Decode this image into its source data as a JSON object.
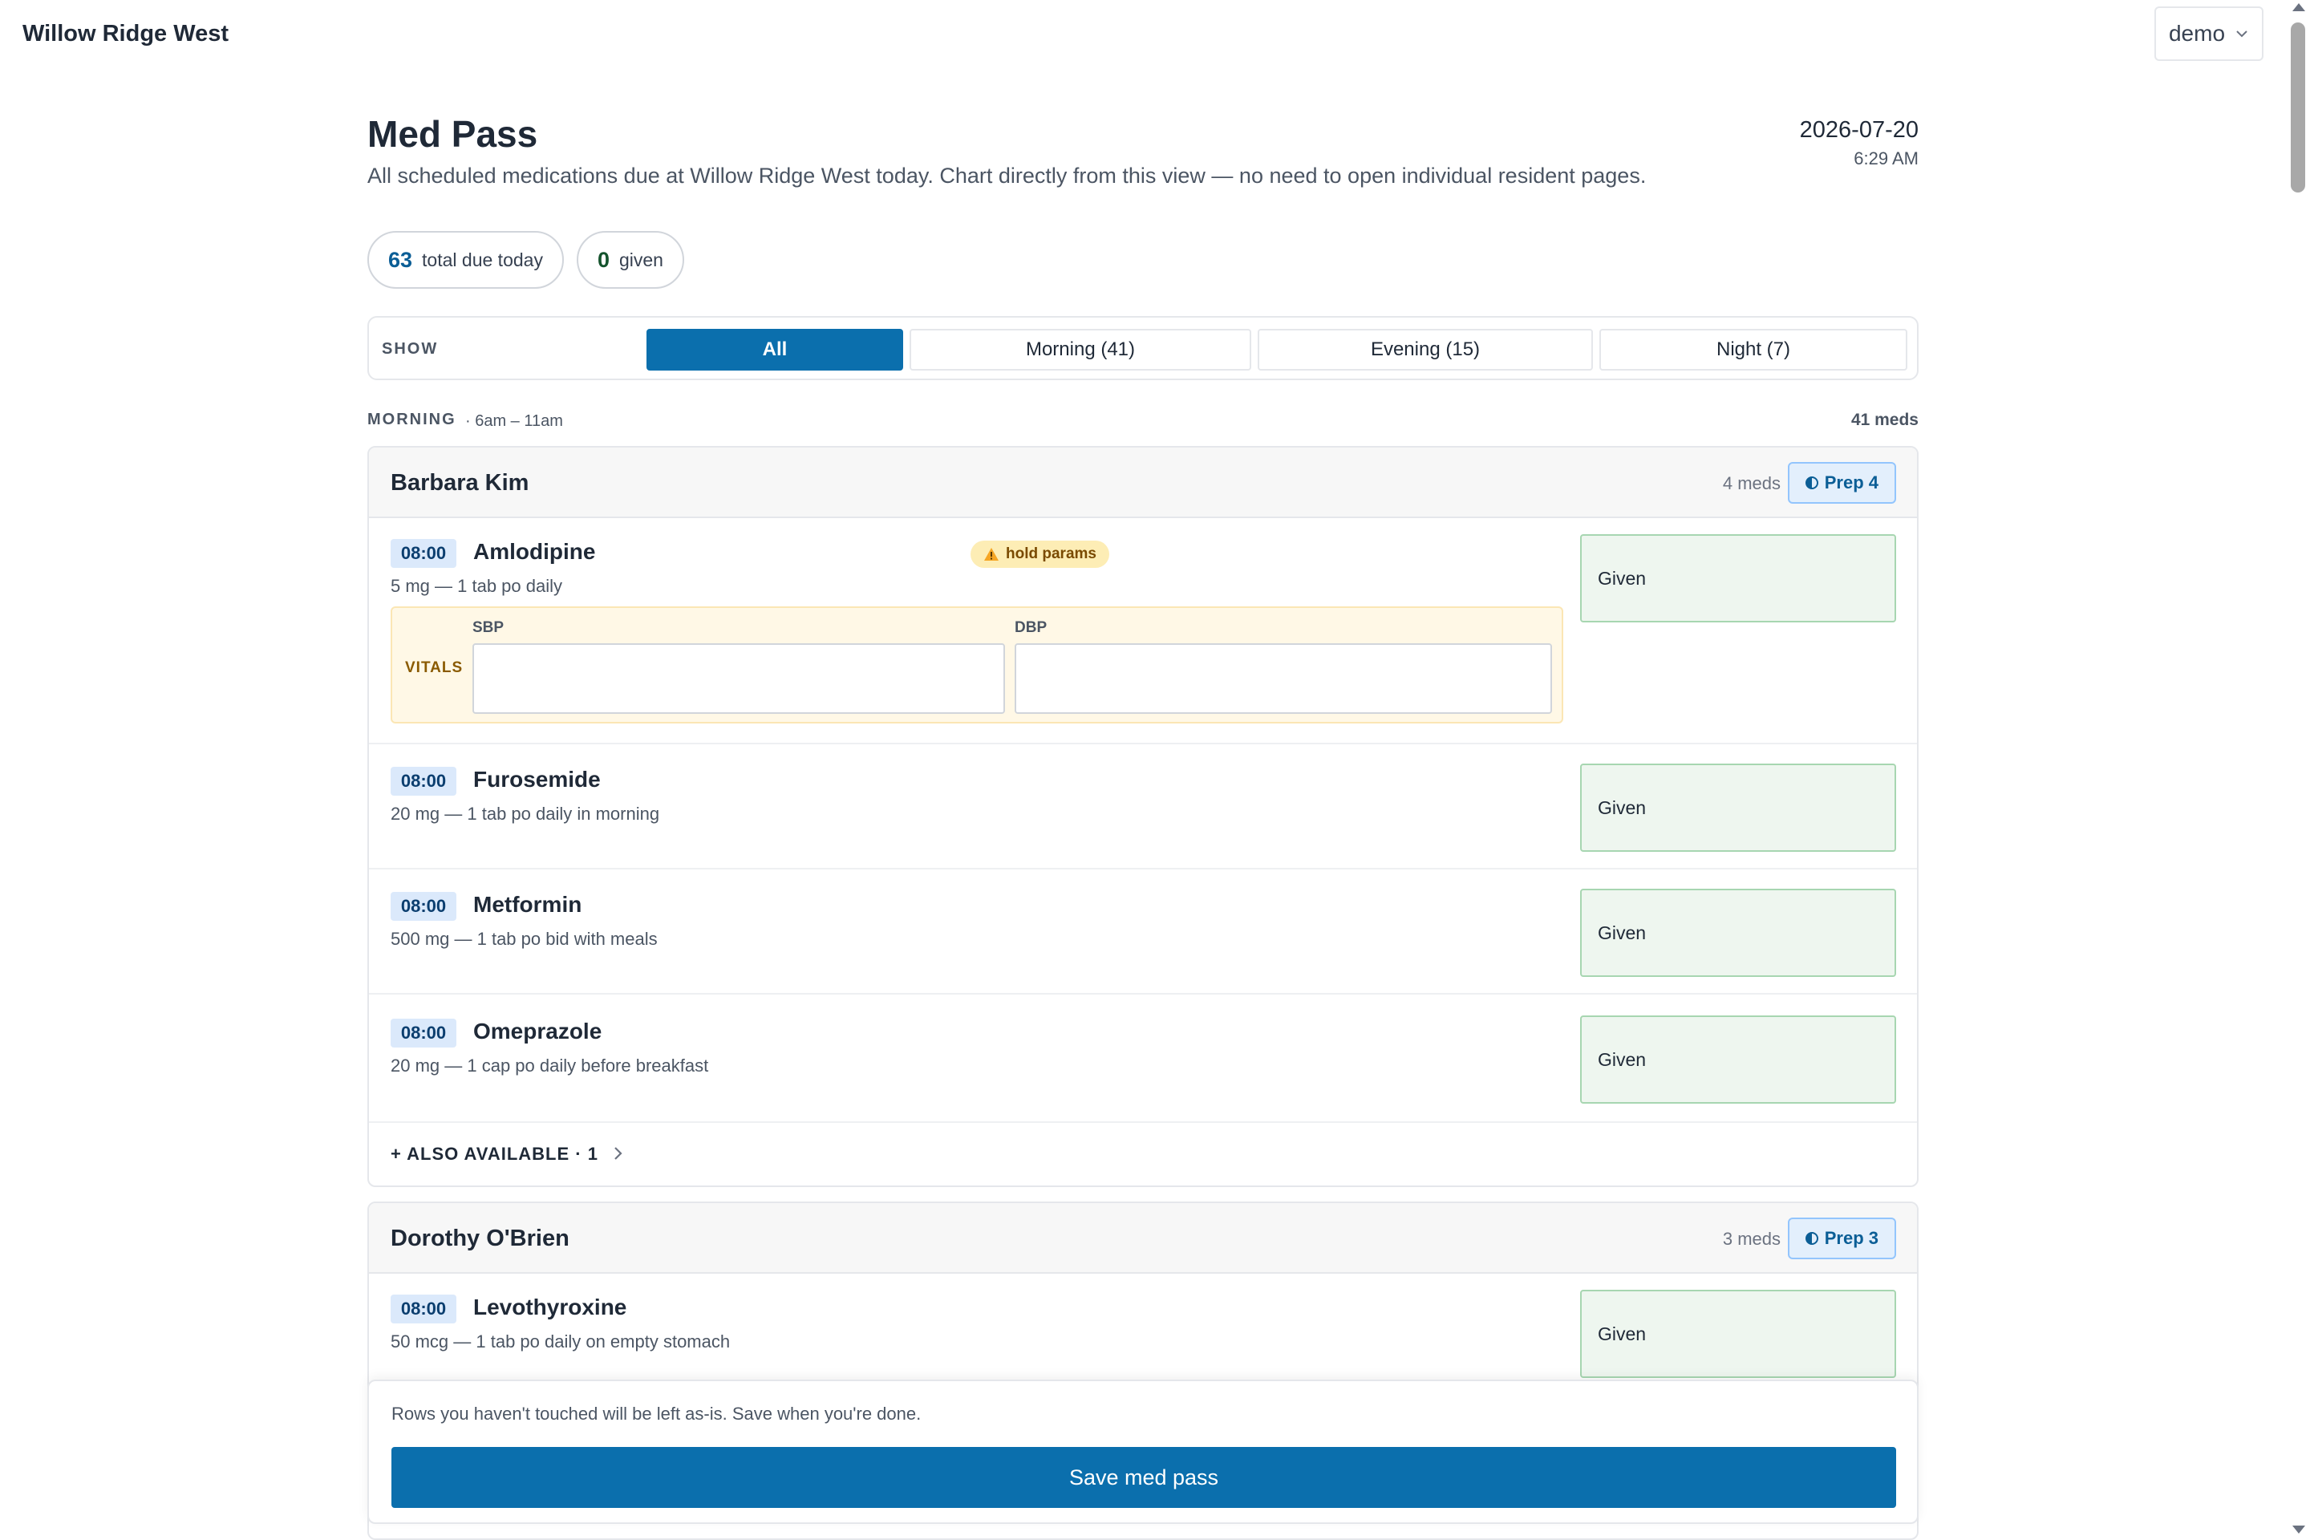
{
  "app": {
    "facility_name": "Willow Ridge West",
    "user_menu_label": "demo"
  },
  "header": {
    "title": "Med Pass",
    "description": "All scheduled medications due at Willow Ridge West today. Chart directly from this view — no need to open individual resident pages.",
    "date": "2026-07-20",
    "time": "6:29 AM"
  },
  "stats": {
    "total_due_value": "63",
    "total_due_label": "total due today",
    "given_value": "0",
    "given_label": "given"
  },
  "filter": {
    "label": "SHOW",
    "tabs": [
      {
        "label": "All",
        "active": true
      },
      {
        "label": "Morning (41)",
        "active": false
      },
      {
        "label": "Evening (15)",
        "active": false
      },
      {
        "label": "Night (7)",
        "active": false
      }
    ]
  },
  "section": {
    "name": "MORNING",
    "range": "· 6am – 11am",
    "count": "41 meds"
  },
  "residents": [
    {
      "name": "Barbara Kim",
      "meds_count": "4 meds",
      "prep_label": "Prep 4",
      "meds": [
        {
          "time": "08:00",
          "name": "Amlodipine",
          "dose": "5 mg — 1 tab po daily",
          "hold_badge": "hold params",
          "vitals": {
            "label": "VITALS",
            "fields": [
              {
                "label": "SBP",
                "value": ""
              },
              {
                "label": "DBP",
                "value": ""
              }
            ]
          },
          "action": "Given"
        },
        {
          "time": "08:00",
          "name": "Furosemide",
          "dose": "20 mg — 1 tab po daily in morning",
          "action": "Given"
        },
        {
          "time": "08:00",
          "name": "Metformin",
          "dose": "500 mg — 1 tab po bid with meals",
          "action": "Given"
        },
        {
          "time": "08:00",
          "name": "Omeprazole",
          "dose": "20 mg — 1 cap po daily before breakfast",
          "action": "Given"
        }
      ],
      "also_available": "+ ALSO AVAILABLE · 1"
    },
    {
      "name": "Dorothy O'Brien",
      "meds_count": "3 meds",
      "prep_label": "Prep 3",
      "meds": [
        {
          "time": "08:00",
          "name": "Levothyroxine",
          "dose": "50 mcg — 1 tab po daily on empty stomach",
          "action": "Given"
        }
      ]
    }
  ],
  "footer": {
    "note": "Rows you haven't touched will be left as-is. Save when you're done.",
    "save_label": "Save med pass"
  },
  "colors": {
    "primary": "#0b6fad",
    "given_bg": "#eef6ef",
    "hold_bg": "#fdedb5",
    "vitals_bg": "#fff8e6"
  }
}
